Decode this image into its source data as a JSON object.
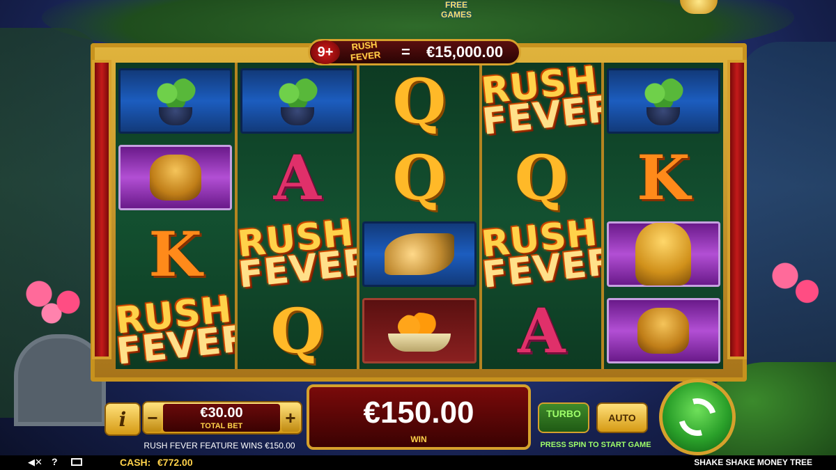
{
  "top": {
    "free_games_label": "FREE GAMES"
  },
  "prize_banner": {
    "count": "9+",
    "rush_word": "RUSH",
    "fever_word": "FEVER",
    "equals": "=",
    "amount": "€15,000.00"
  },
  "reels": [
    [
      "bamboo",
      "frog",
      "K",
      "rush_fever"
    ],
    [
      "bamboo",
      "A",
      "rush_fever",
      "Q"
    ],
    [
      "Q",
      "Q",
      "bird",
      "oranges"
    ],
    [
      "rush_fever",
      "Q",
      "rush_fever",
      "A"
    ],
    [
      "bamboo",
      "K",
      "lion",
      "frog"
    ]
  ],
  "rush_fever_label": {
    "line1": "RUSH",
    "line2": "FEVER"
  },
  "controls": {
    "info_label": "i",
    "minus_label": "−",
    "plus_label": "+",
    "bet_value": "€30.00",
    "bet_label": "TOTAL BET",
    "feature_text": "RUSH FEVER FEATURE WINS €150.00",
    "win_value": "€150.00",
    "win_label": "WIN",
    "turbo_label": "TURBO",
    "auto_label": "AUTO",
    "press_text": "PRESS SPIN TO START GAME"
  },
  "status": {
    "sound_icon": "speaker-muted-icon",
    "help_label": "?",
    "cash_label": "CASH:",
    "cash_value": "€772.00",
    "game_title": "SHAKE SHAKE MONEY TREE"
  },
  "colors": {
    "gold": "#d6a12c",
    "win_red": "#7a0a0a",
    "spin_green": "#2aa02a"
  }
}
